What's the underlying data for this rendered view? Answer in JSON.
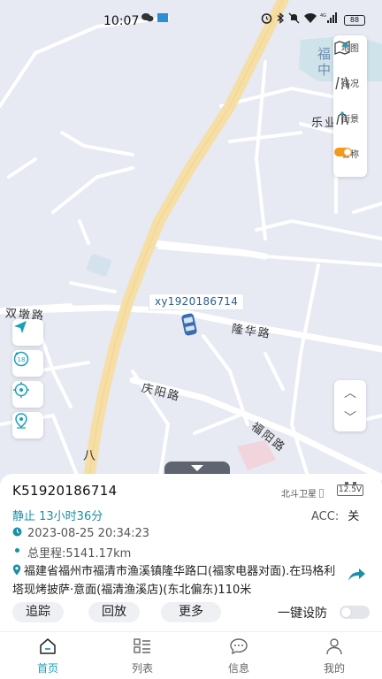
{
  "status_bar": {
    "time": "10:07",
    "battery": "88"
  },
  "map": {
    "labels": {
      "road_shuangtun": "双墩路",
      "road_longhua": "隆华路",
      "road_qingyang": "庆阳路",
      "road_fuyang": "福阳路",
      "road_eight": "八",
      "road_leye": "乐业",
      "poi_fuqing_1": "福  溪",
      "poi_fuqing_2": "中   学"
    },
    "layer_controls": [
      {
        "label": "地图",
        "icon": "map-icon"
      },
      {
        "label": "路况",
        "icon": "traffic-icon"
      },
      {
        "label": "街景",
        "icon": "street-view-icon"
      },
      {
        "label": "名称",
        "icon": "toggle-icon"
      }
    ],
    "zoom": {
      "up": "︿",
      "down": "﹀"
    },
    "vehicle_label": "xy1920186714",
    "left_tools": [
      {
        "icon": "navigate-icon"
      },
      {
        "icon": "playback-speed-icon",
        "text": "18"
      },
      {
        "icon": "locate-target-icon"
      },
      {
        "icon": "location-pin-icon"
      }
    ]
  },
  "panel": {
    "plate": "K51920186714",
    "signal": "北斗卫星",
    "battery_voltage": "12.5V",
    "status": "静止 13小时36分",
    "acc_label": "ACC:",
    "acc_value": "关",
    "timestamp": "2023-08-25 20:34:23",
    "mileage": "总里程:5141.17km",
    "address": "福建省福州市福清市渔溪镇隆华路口(福家电器对面).在玛格利塔现烤披萨·意面(福清渔溪店)(东北偏东)110米",
    "actions": [
      "追踪",
      "回放",
      "更多"
    ],
    "arm_label": "一键设防",
    "arm_on": false,
    "accent": "#1a8fa8"
  },
  "bottom_nav": [
    {
      "label": "首页",
      "icon": "home-icon",
      "active": true
    },
    {
      "label": "列表",
      "icon": "list-icon",
      "active": false
    },
    {
      "label": "信息",
      "icon": "message-icon",
      "active": false
    },
    {
      "label": "我的",
      "icon": "user-icon",
      "active": false
    }
  ]
}
